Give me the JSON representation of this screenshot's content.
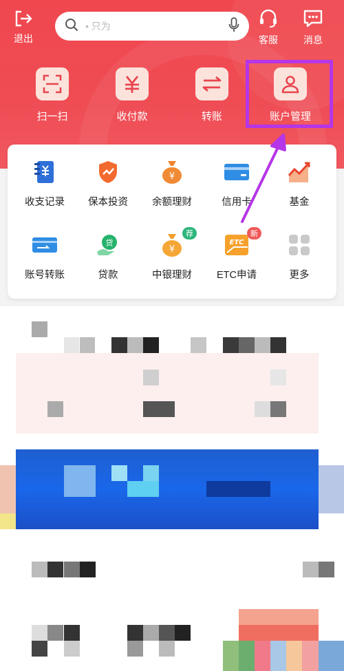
{
  "header": {
    "logout_label": "退出",
    "search_placeholder": "•  只为",
    "service_label": "客服",
    "messages_label": "消息"
  },
  "quick_actions": [
    {
      "label": "扫一扫",
      "icon": "scan-icon"
    },
    {
      "label": "收付款",
      "icon": "yuan-icon"
    },
    {
      "label": "转账",
      "icon": "transfer-icon"
    },
    {
      "label": "账户管理",
      "icon": "user-icon"
    }
  ],
  "services": [
    {
      "label": "收支记录",
      "icon": "ledger-icon"
    },
    {
      "label": "保本投资",
      "icon": "shield-chart-icon"
    },
    {
      "label": "余额理财",
      "icon": "money-bag-icon"
    },
    {
      "label": "信用卡",
      "icon": "credit-card-icon"
    },
    {
      "label": "基金",
      "icon": "fund-chart-icon"
    },
    {
      "label": "账号转账",
      "icon": "card-transfer-icon"
    },
    {
      "label": "贷款",
      "icon": "loan-icon"
    },
    {
      "label": "中银理财",
      "icon": "wealth-bag-icon",
      "badge": "荐"
    },
    {
      "label": "ETC申请",
      "icon": "etc-icon",
      "badge": "新"
    },
    {
      "label": "更多",
      "icon": "more-grid-icon"
    }
  ],
  "colors": {
    "brand_red": "#ef4a52",
    "highlight": "#b535e8",
    "badge_green": "#2db57c",
    "badge_red": "#f05a5a"
  }
}
